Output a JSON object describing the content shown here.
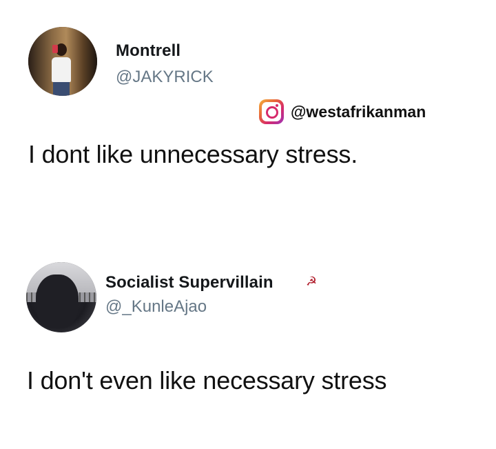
{
  "tweet1": {
    "name": "Montrell",
    "handle": "@JAKYRICK",
    "text": "I dont like unnecessary stress."
  },
  "watermark": {
    "icon": "instagram-icon",
    "handle": "@westafrikanman"
  },
  "tweet2": {
    "name": "Socialist Supervillain",
    "name_symbol": "☭",
    "handle": "@_KunleAjao",
    "text": "I don't even like necessary stress"
  }
}
